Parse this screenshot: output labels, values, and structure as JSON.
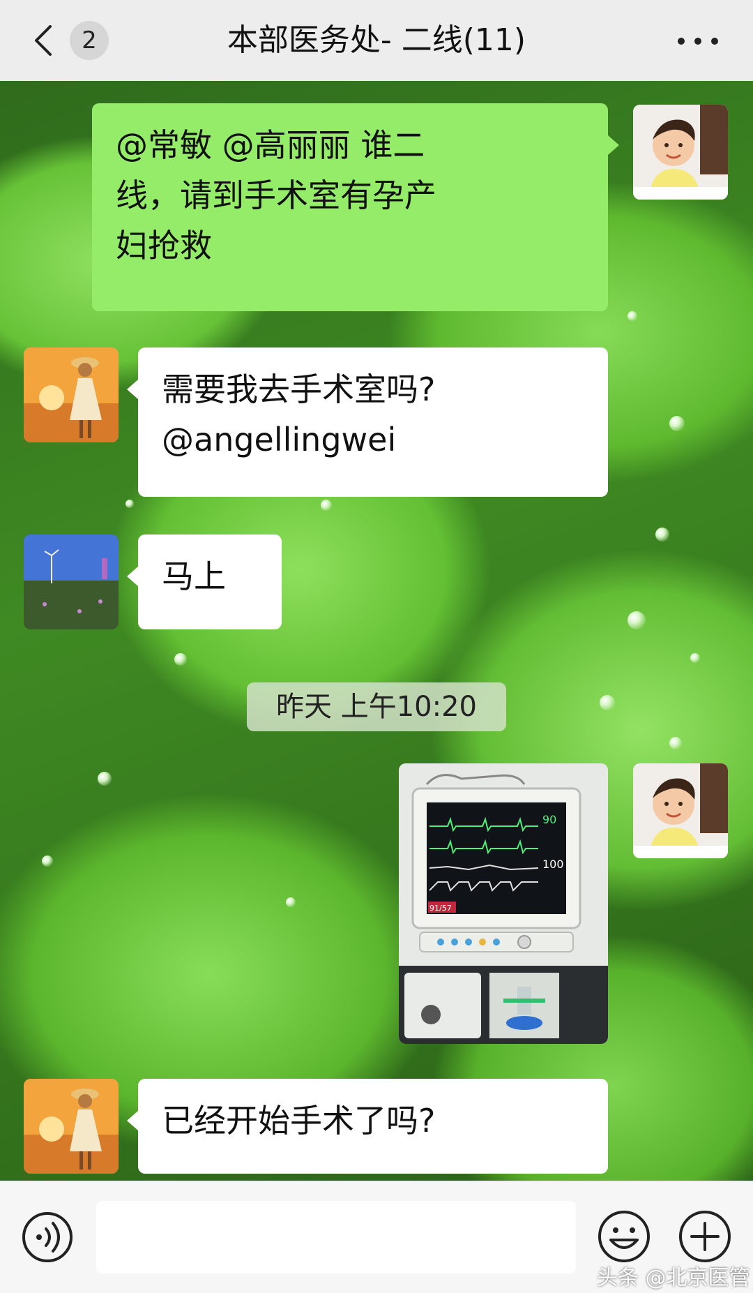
{
  "header": {
    "back_unread_count": "2",
    "title": "本部医务处- 二线(11)"
  },
  "messages": [
    {
      "direction": "outgoing",
      "avatar": "baby-avatar",
      "text_lines": [
        "@常敏 @高丽丽 谁二",
        "线，请到手术室有孕产",
        "妇抢救"
      ]
    },
    {
      "direction": "incoming",
      "avatar": "sunset-girl-avatar",
      "text_lines": [
        "需要我去手术室吗?",
        "@angellingwei"
      ]
    },
    {
      "direction": "incoming",
      "avatar": "field-avatar",
      "text_lines": [
        "马上"
      ]
    },
    {
      "type": "timestamp",
      "text": "昨天 上午10:20"
    },
    {
      "direction": "outgoing",
      "avatar": "baby-avatar",
      "type": "image",
      "image": {
        "description_icon": "anesthesia-monitor-photo",
        "readouts": [
          "90",
          "100",
          "91/57"
        ]
      }
    },
    {
      "direction": "incoming",
      "avatar": "sunset-girl-avatar",
      "text_lines": [
        "已经开始手术了吗?"
      ]
    }
  ],
  "inputbar": {
    "input_value": "",
    "voice_icon": "voice-icon",
    "emoji_icon": "emoji-icon",
    "plus_icon": "plus-icon"
  },
  "watermark": "头条 @北京医管",
  "colors": {
    "outgoing_bubble": "#95ec69",
    "incoming_bubble": "#ffffff",
    "header_bg": "#ededed"
  }
}
